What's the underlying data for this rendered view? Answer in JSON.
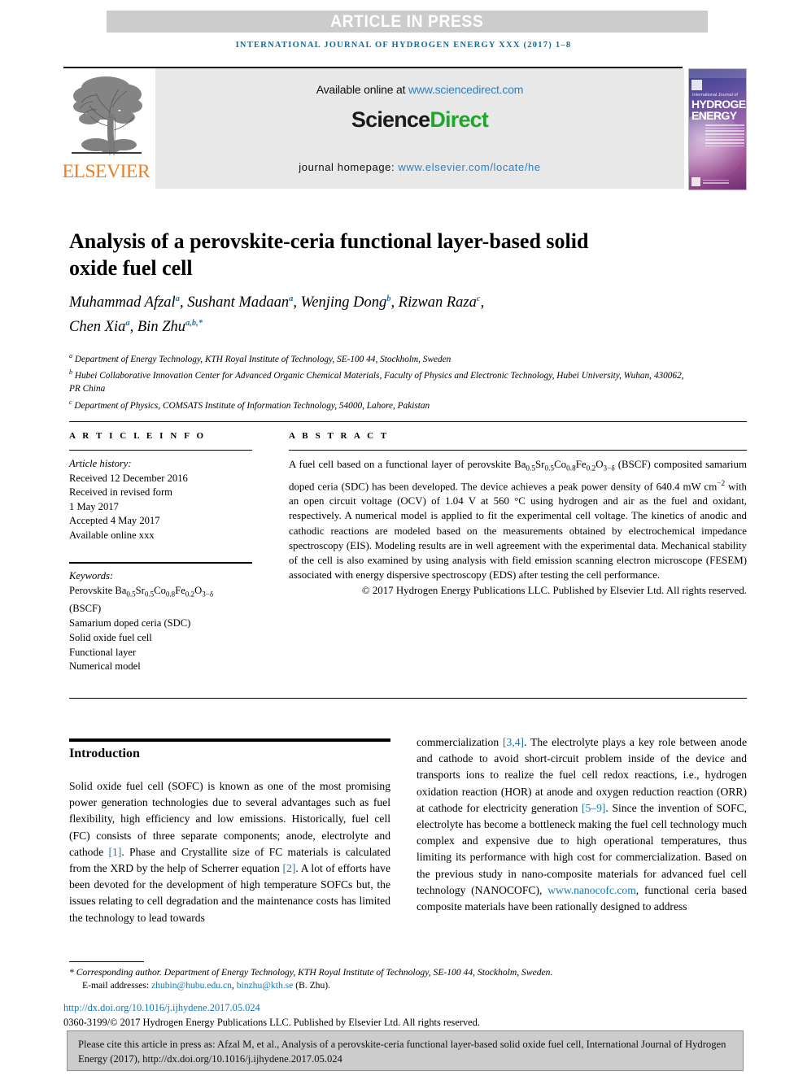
{
  "banner": {
    "label": "ARTICLE IN PRESS"
  },
  "running_head": "INTERNATIONAL JOURNAL OF HYDROGEN ENERGY XXX (2017) 1–8",
  "masthead": {
    "publisher_wordmark": "ELSEVIER",
    "available_prefix": "Available online at ",
    "available_link": "www.sciencedirect.com",
    "brand_part1": "Science",
    "brand_part2": "Direct",
    "homepage_label": "journal homepage: ",
    "homepage_link": "www.elsevier.com/locate/he",
    "cover": {
      "line1": "International Journal of",
      "line2": "HYDROGEN",
      "line3": "ENERGY"
    }
  },
  "article": {
    "title": "Analysis of a perovskite-ceria functional layer-based solid oxide fuel cell",
    "authors_line1_a": "Muhammad Afzal",
    "authors_line1_a_sup": "a",
    "authors_line1_b": "Sushant Madaan",
    "authors_line1_b_sup": "a",
    "authors_line1_c": "Wenjing Dong",
    "authors_line1_c_sup": "b",
    "authors_line1_d": "Rizwan Raza",
    "authors_line1_d_sup": "c",
    "authors_line2_a": "Chen Xia",
    "authors_line2_a_sup": "a",
    "authors_line2_b": "Bin Zhu",
    "authors_line2_b_sup": "a,b,*",
    "affiliations": [
      {
        "marker": "a",
        "text": "Department of Energy Technology, KTH Royal Institute of Technology, SE-100 44, Stockholm, Sweden"
      },
      {
        "marker": "b",
        "text": "Hubei Collaborative Innovation Center for Advanced Organic Chemical Materials, Faculty of Physics and Electronic Technology, Hubei University, Wuhan, 430062, PR China"
      },
      {
        "marker": "c",
        "text": "Department of Physics, COMSATS Institute of Information Technology, 54000, Lahore, Pakistan"
      }
    ]
  },
  "article_info": {
    "heading": "A R T I C L E    I N F O",
    "history_label": "Article history:",
    "history": [
      "Received 12 December 2016",
      "Received in revised form",
      "1 May 2017",
      "Accepted 4 May 2017",
      "Available online xxx"
    ],
    "keywords_label": "Keywords:",
    "keywords": [
      "Perovskite Ba0.5Sr0.5Co0.8Fe0.2O3−δ (BSCF)",
      "Samarium doped ceria (SDC)",
      "Solid oxide fuel cell",
      "Functional layer",
      "Numerical model"
    ]
  },
  "abstract": {
    "heading": "A B S T R A C T",
    "body_part1": "A fuel cell based on a functional layer of perovskite Ba",
    "body_part2": " (BSCF) composited samarium doped ceria (SDC) has been developed. The device achieves a peak power density of 640.4 mW cm",
    "body_part3": " with an open circuit voltage (OCV) of 1.04 V at 560 °C using hydrogen and air as the fuel and oxidant, respectively. A numerical model is applied to fit the experimental cell voltage. The kinetics of anodic and cathodic reactions are modeled based on the measurements obtained by electrochemical impedance spectroscopy (EIS). Modeling results are in well agreement with the experimental data. Mechanical stability of the cell is also examined by using analysis with field emission scanning electron microscope (FESEM) associated with energy dispersive spectroscopy (EDS) after testing the cell performance.",
    "copyright": "© 2017 Hydrogen Energy Publications LLC. Published by Elsevier Ltd. All rights reserved."
  },
  "introduction": {
    "heading": "Introduction",
    "left_part1": "Solid oxide fuel cell (SOFC) is known as one of the most promising power generation technologies due to several advantages such as fuel flexibility, high efficiency and low emissions. Historically, fuel cell (FC) consists of three separate components; anode, electrolyte and cathode ",
    "ref1": "[1]",
    "left_part2": ". Phase and Crystallite size of FC materials is calculated from the XRD by the help of Scherrer equation ",
    "ref2": "[2]",
    "left_part3": ". A lot of efforts have been devoted for the development of high temperature SOFCs but, the issues relating to cell degradation and the maintenance costs has limited the technology to lead towards",
    "right_part1": "commercialization ",
    "ref34": "[3,4]",
    "right_part2": ". The electrolyte plays a key role between anode and cathode to avoid short-circuit problem inside of the device and transports ions to realize the fuel cell redox reactions, i.e., hydrogen oxidation reaction (HOR) at anode and oxygen reduction reaction (ORR) at cathode for electricity generation ",
    "ref59": "[5–9]",
    "right_part3": ". Since the invention of SOFC, electrolyte has become a bottleneck making the fuel cell technology much complex and expensive due to high operational temperatures, thus limiting its performance with high cost for commercialization. Based on the previous study in nano-composite materials for advanced fuel cell technology (NANOCOFC), ",
    "nanocofc_link": "www.nanocofc.com",
    "right_part4": ", functional ceria based composite materials have been rationally designed to address"
  },
  "footnotes": {
    "corresponding": "* Corresponding author. Department of Energy Technology, KTH Royal Institute of Technology, SE-100 44, Stockholm, Sweden.",
    "email_label": "E-mail addresses: ",
    "email1": "zhubin@hubu.edu.cn",
    "email2": "binzhu@kth.se",
    "email_suffix": " (B. Zhu).",
    "doi": "http://dx.doi.org/10.1016/j.ijhydene.2017.05.024",
    "issn": "0360-3199/© 2017 Hydrogen Energy Publications LLC. Published by Elsevier Ltd. All rights reserved."
  },
  "cite_box": {
    "text": "Please cite this article in press as: Afzal M, et al., Analysis of a perovskite-ceria functional layer-based solid oxide fuel cell, International Journal of Hydrogen Energy (2017), http://dx.doi.org/10.1016/j.ijhydene.2017.05.024"
  },
  "colors": {
    "banner_bg": "#cccccc",
    "journal_blue": "#0b6e9e",
    "link_blue": "#1577b5",
    "elsevier_orange": "#ef7d21",
    "sciencedirect_green": "#1ea72a",
    "panel_gray": "#e8e8e8"
  }
}
